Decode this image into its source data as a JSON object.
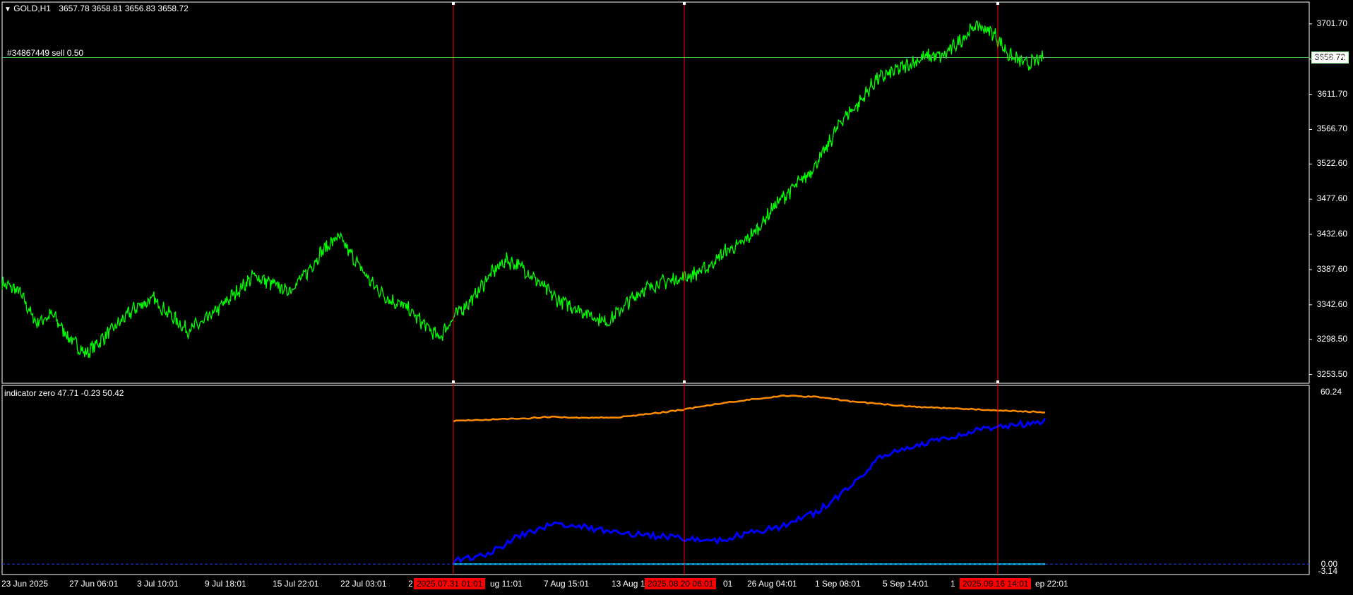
{
  "symbol_header": {
    "arrow": "▼",
    "symbol": "GOLD,H1",
    "ohlc": "3657.78 3658.81 3656.83 3658.72"
  },
  "order_line": {
    "label": "#34867449 sell 0.50",
    "price": 3658.72
  },
  "current_price_label": "3658.72",
  "price_axis": {
    "ticks": [
      "3701.70",
      "3656.70",
      "3611.70",
      "3566.70",
      "3522.60",
      "3477.60",
      "3432.60",
      "3387.60",
      "3342.60",
      "3298.50",
      "3253.50"
    ]
  },
  "indicator_pane": {
    "label": "indicator zero 47.71 -0.23 50.42",
    "axis_top": "60.24",
    "axis_zero": "0.00",
    "axis_below": "-3.14"
  },
  "time_axis": {
    "ticks": [
      "23 Jun 2025",
      "27 Jun 06:01",
      "3 Jul 10:01",
      "9 Jul 18:01",
      "15 Jul 22:01",
      "22 Jul 03:01",
      "2",
      "ug 11:01",
      "7 Aug 15:01",
      "13 Aug 1",
      "01",
      "26 Aug 04:01",
      "1 Sep 08:01",
      "5 Sep 14:01",
      "1",
      "ep 22:01"
    ]
  },
  "vertical_lines": [
    {
      "label": "2025.07.31 01:01"
    },
    {
      "label": "2025.08.20 06:01"
    },
    {
      "label": "2025.09.16 14:01"
    }
  ],
  "colors": {
    "price_line": "#00ff00",
    "grid_line": "#ffffff",
    "vertical_line": "#ff0000",
    "orange_series": "#ff8c00",
    "blue_series": "#0000ff",
    "cyan_series": "#00e5ff",
    "zero_dashed": "#1e3cff"
  },
  "chart_data": {
    "type": "line",
    "price_series_waypoints": [
      3370,
      3360,
      3320,
      3330,
      3300,
      3280,
      3300,
      3320,
      3340,
      3350,
      3330,
      3310,
      3320,
      3340,
      3360,
      3380,
      3370,
      3360,
      3380,
      3410,
      3430,
      3400,
      3370,
      3350,
      3340,
      3320,
      3300,
      3330,
      3350,
      3380,
      3400,
      3390,
      3370,
      3350,
      3340,
      3330,
      3320,
      3340,
      3360,
      3370,
      3375,
      3380,
      3390,
      3410,
      3420,
      3440,
      3470,
      3490,
      3510,
      3540,
      3580,
      3600,
      3630,
      3640,
      3650,
      3660,
      3660,
      3680,
      3700,
      3690,
      3660,
      3650,
      3658
    ],
    "indicator_series": [
      {
        "name": "orange",
        "values": [
          50.0,
          50.5,
          50.8,
          51.5,
          51.0,
          51.3,
          52.5,
          54.0,
          56.0,
          57.5,
          58.8,
          58.5,
          57.0,
          56.0,
          55.0,
          54.5,
          54.0,
          53.5,
          53.0
        ]
      },
      {
        "name": "blue",
        "values": [
          1,
          3,
          10,
          14,
          13,
          11,
          10,
          9,
          8,
          11,
          13,
          18,
          26,
          38,
          41,
          44,
          47,
          48.5,
          50
        ]
      },
      {
        "name": "cyan",
        "values": [
          0,
          0,
          0,
          0,
          0,
          0,
          0,
          0,
          0,
          0,
          0,
          0,
          0,
          0,
          0,
          0,
          0,
          0,
          0
        ]
      }
    ],
    "price_ylim": [
      3245,
      3725
    ],
    "indicator_ylim": [
      -3.14,
      60.24
    ]
  }
}
